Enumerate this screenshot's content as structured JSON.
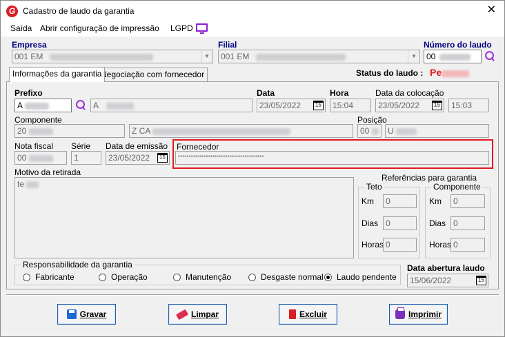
{
  "window": {
    "title": "Cadastro de laudo da garantia"
  },
  "menu": {
    "items": [
      "Saída",
      "Abrir configuração de impressão",
      "LGPD"
    ]
  },
  "header": {
    "empresa_label": "Empresa",
    "empresa_value": "001 EM",
    "filial_label": "Filial",
    "filial_value": "001 EM",
    "numero_label": "Número do laudo",
    "numero_value": "00"
  },
  "tabs": [
    "Informações da garantia",
    "Negociação com fornecedor"
  ],
  "status": {
    "label": "Status do laudo :",
    "value": "Pe"
  },
  "form": {
    "prefixo_label": "Prefixo",
    "prefixo_value": "A",
    "prefixo_desc": "A",
    "data_label": "Data",
    "data_value": "23/05/2022",
    "hora_label": "Hora",
    "hora_value": "15:04",
    "data_colocacao_label": "Data da colocação",
    "data_colocacao_value": "23/05/2022",
    "hora_colocacao_value": "15:03",
    "componente_label": "Componente",
    "componente_value": "20",
    "componente_desc": "Z CA",
    "posicao_label": "Posição",
    "posicao_value": "00",
    "posicao_desc": "U",
    "nota_fiscal_label": "Nota fiscal",
    "nota_fiscal_value": "00",
    "serie_label": "Série",
    "serie_value": "1",
    "data_emissao_label": "Data de emissão",
    "data_emissao_value": "23/05/2022",
    "fornecedor_label": "Fornecedor",
    "fornecedor_value": "****************************************",
    "motivo_label": "Motivo da retirada",
    "motivo_value": "te"
  },
  "referencias": {
    "title": "Referências para garantia",
    "teto": {
      "title": "Teto",
      "km_label": "Km",
      "km_value": "0",
      "dias_label": "Dias",
      "dias_value": "0",
      "horas_label": "Horas",
      "horas_value": "0"
    },
    "componente": {
      "title": "Componente",
      "km_label": "Km",
      "km_value": "0",
      "dias_label": "Dias",
      "dias_value": "0",
      "horas_label": "Horas",
      "horas_value": "0"
    }
  },
  "responsabilidade": {
    "title": "Responsabilidade da garantia",
    "options": [
      "Fabricante",
      "Operação",
      "Manutenção",
      "Desgaste normal",
      "Laudo pendente"
    ],
    "selected": "Laudo pendente"
  },
  "abertura": {
    "label": "Data abertura laudo",
    "value": "15/06/2022"
  },
  "calendar_icon_text": "15",
  "buttons": {
    "gravar": "Gravar",
    "limpar": "Limpar",
    "excluir": "Excluir",
    "imprimir": "Imprimir"
  },
  "colors": {
    "accent": "#000080",
    "status": "#e0191f",
    "highlight_border": "#e0191f",
    "lgpd_icon": "#8b1fd1"
  }
}
